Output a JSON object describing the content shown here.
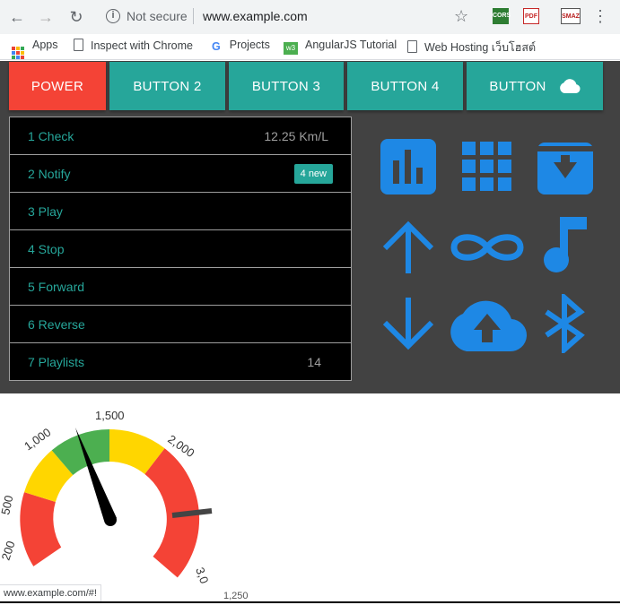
{
  "browser": {
    "url_security": "Not secure",
    "url": "www.example.com",
    "extensions": [
      "CORS",
      "PDF",
      "SMAZ"
    ],
    "bookmarks": [
      {
        "label": "Apps",
        "icon": "apps-grid-icon"
      },
      {
        "label": "Inspect with Chrome",
        "icon": "document-icon"
      },
      {
        "label": "Projects",
        "icon": "google-icon"
      },
      {
        "label": "AngularJS Tutorial",
        "icon": "w3-icon"
      },
      {
        "label": "Web Hosting เว็บโฮสต์",
        "icon": "document-icon"
      }
    ],
    "status_url": "www.example.com/#!"
  },
  "buttons": [
    {
      "label": "POWER",
      "color": "#f44336"
    },
    {
      "label": "BUTTON 2",
      "color": "#26a69a"
    },
    {
      "label": "BUTTON 3",
      "color": "#26a69a"
    },
    {
      "label": "BUTTON 4",
      "color": "#26a69a"
    },
    {
      "label": "BUTTON",
      "color": "#26a69a",
      "icon": "cloud-icon"
    }
  ],
  "list": [
    {
      "label": "1 Check",
      "secondary": "12.25 Km/L"
    },
    {
      "label": "2 Notify",
      "badge": "4 new"
    },
    {
      "label": "3 Play"
    },
    {
      "label": "4 Stop"
    },
    {
      "label": "5 Forward"
    },
    {
      "label": "6 Reverse"
    },
    {
      "label": "7 Playlists",
      "secondary": "14"
    }
  ],
  "icon_grid": [
    "bar-chart-icon",
    "apps-grid-icon",
    "archive-icon",
    "arrow-up-icon",
    "infinity-icon",
    "music-note-icon",
    "arrow-down-icon",
    "cloud-upload-icon",
    "bluetooth-icon"
  ],
  "icon_color": "#1e88e5",
  "gauge": {
    "labels": [
      "200",
      "500",
      "1,000",
      "1,500",
      "2,000",
      "3,0"
    ],
    "bottom_label": "1,250",
    "needle_value": 1250
  },
  "colors": {
    "red": "#f44336",
    "teal": "#26a69a",
    "yellow": "#ffd600",
    "green": "#4caf50",
    "panel": "#424242"
  }
}
